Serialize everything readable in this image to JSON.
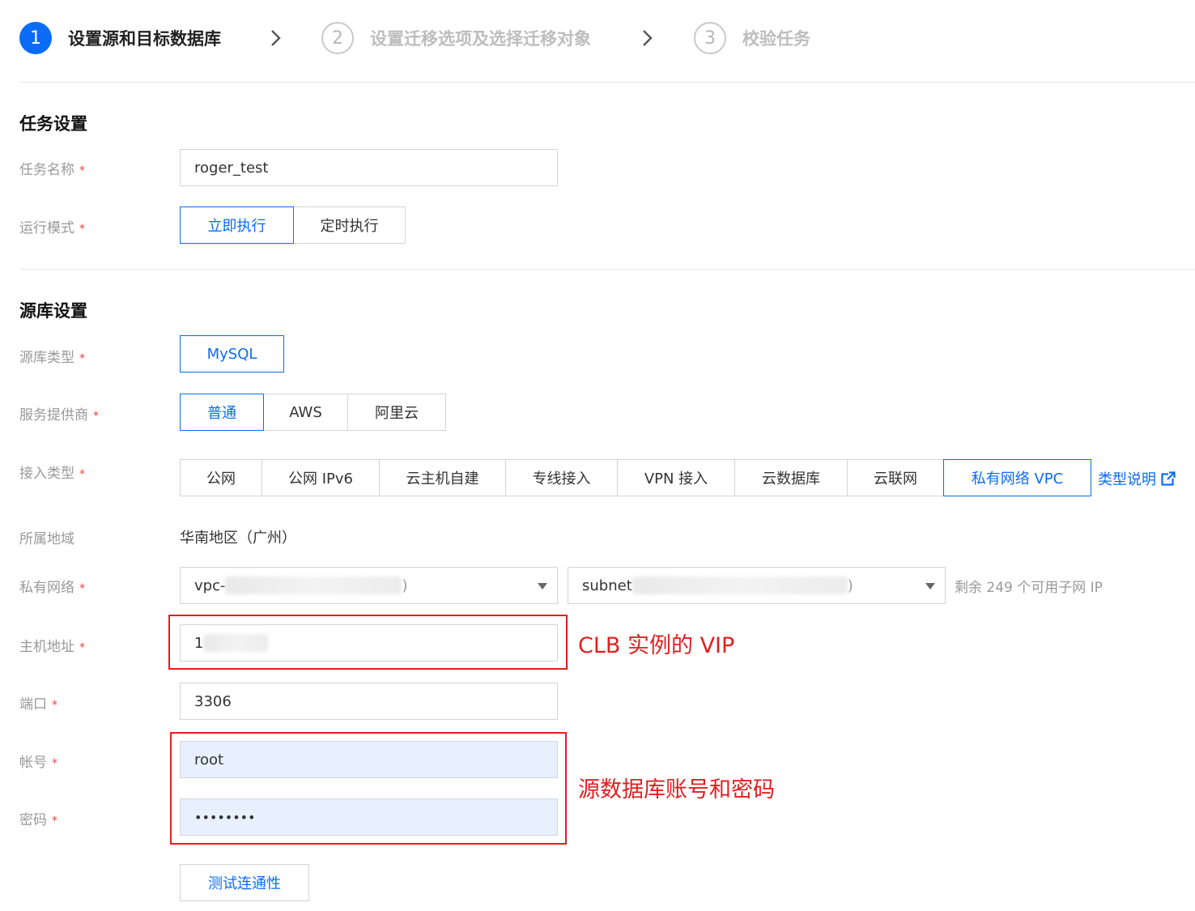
{
  "stepper": {
    "steps": [
      {
        "number": "1",
        "label": "设置源和目标数据库"
      },
      {
        "number": "2",
        "label": "设置迁移选项及选择迁移对象"
      },
      {
        "number": "3",
        "label": "校验任务"
      }
    ]
  },
  "task_settings": {
    "title": "任务设置",
    "name_label": "任务名称",
    "name_value": "roger_test",
    "mode_label": "运行模式",
    "mode_options": [
      "立即执行",
      "定时执行"
    ],
    "mode_selected": "立即执行"
  },
  "source_settings": {
    "title": "源库设置",
    "db_type_label": "源库类型",
    "db_type_value": "MySQL",
    "provider_label": "服务提供商",
    "provider_options": [
      "普通",
      "AWS",
      "阿里云"
    ],
    "provider_selected": "普通",
    "access_label": "接入类型",
    "access_options": [
      "公网",
      "公网 IPv6",
      "云主机自建",
      "专线接入",
      "VPN 接入",
      "云数据库",
      "云联网",
      "私有网络 VPC"
    ],
    "access_selected": "私有网络 VPC",
    "access_help_link": "类型说明",
    "region_label": "所属地域",
    "region_value": "华南地区（广州）",
    "vpc_label": "私有网络",
    "vpc_value_prefix": "vpc-",
    "vpc_value_suffix": ")",
    "subnet_value_prefix": "subnet",
    "subnet_value_suffix": ")",
    "subnet_hint": "剩余 249 个可用子网 IP",
    "host_label": "主机地址",
    "host_value": "1",
    "port_label": "端口",
    "port_value": "3306",
    "account_label": "帐号",
    "account_value": "root",
    "password_label": "密码",
    "password_value": "••••••••",
    "test_button": "测试连通性"
  },
  "annotations": {
    "host_note": "CLB 实例的 VIP",
    "credentials_note": "源数据库账号和密码"
  },
  "colors": {
    "primary": "#0a6cf5",
    "annotation_red": "#e02020",
    "required_star": "#e54545",
    "filled_input_bg": "#e8f0fe"
  }
}
